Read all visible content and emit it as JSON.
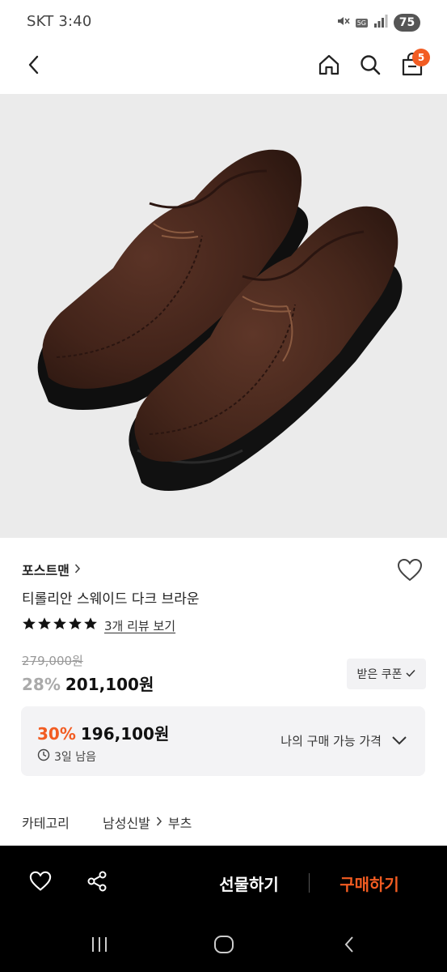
{
  "status_bar": {
    "carrier_time": "SKT 3:40",
    "network": "5G",
    "battery": "75"
  },
  "header": {
    "cart_count": "5",
    "icons": [
      "back-arrow-icon",
      "home-icon",
      "search-icon",
      "shopping-bag-icon"
    ]
  },
  "product": {
    "brand": "포스트맨",
    "name": "티롤리안 스웨이드 다크 브라운",
    "rating_stars": 5,
    "review_link": "3개 리뷰 보기",
    "original_price": "279,000원",
    "discount_rate": "28%",
    "sale_price": "201,100원",
    "coupon_label": "받은 쿠폰",
    "my_price": {
      "rate": "30%",
      "price": "196,100원",
      "remaining": "3일 남음",
      "label": "나의 구매 가능 가격"
    },
    "category": {
      "label": "카테고리",
      "path": [
        "남성신발",
        "부츠"
      ]
    }
  },
  "bottom_bar": {
    "gift_label": "선물하기",
    "buy_label": "구매하기"
  },
  "colors": {
    "accent": "#f25c22",
    "bar_bg": "#000000",
    "image_bg": "#ebebeb"
  }
}
